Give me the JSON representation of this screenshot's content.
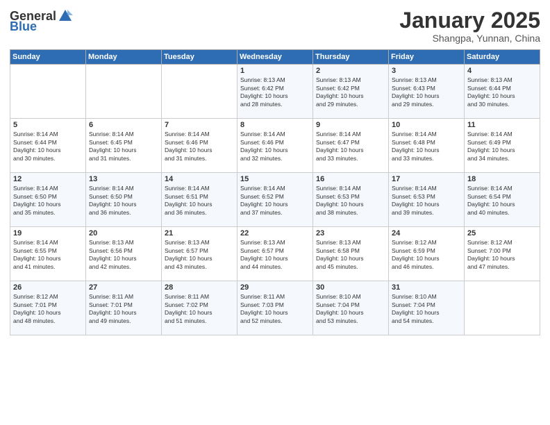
{
  "logo": {
    "text_general": "General",
    "text_blue": "Blue"
  },
  "header": {
    "month_title": "January 2025",
    "location": "Shangpa, Yunnan, China"
  },
  "days_of_week": [
    "Sunday",
    "Monday",
    "Tuesday",
    "Wednesday",
    "Thursday",
    "Friday",
    "Saturday"
  ],
  "weeks": [
    [
      {
        "day": "",
        "info": ""
      },
      {
        "day": "",
        "info": ""
      },
      {
        "day": "",
        "info": ""
      },
      {
        "day": "1",
        "info": "Sunrise: 8:13 AM\nSunset: 6:42 PM\nDaylight: 10 hours\nand 28 minutes."
      },
      {
        "day": "2",
        "info": "Sunrise: 8:13 AM\nSunset: 6:42 PM\nDaylight: 10 hours\nand 29 minutes."
      },
      {
        "day": "3",
        "info": "Sunrise: 8:13 AM\nSunset: 6:43 PM\nDaylight: 10 hours\nand 29 minutes."
      },
      {
        "day": "4",
        "info": "Sunrise: 8:13 AM\nSunset: 6:44 PM\nDaylight: 10 hours\nand 30 minutes."
      }
    ],
    [
      {
        "day": "5",
        "info": "Sunrise: 8:14 AM\nSunset: 6:44 PM\nDaylight: 10 hours\nand 30 minutes."
      },
      {
        "day": "6",
        "info": "Sunrise: 8:14 AM\nSunset: 6:45 PM\nDaylight: 10 hours\nand 31 minutes."
      },
      {
        "day": "7",
        "info": "Sunrise: 8:14 AM\nSunset: 6:46 PM\nDaylight: 10 hours\nand 31 minutes."
      },
      {
        "day": "8",
        "info": "Sunrise: 8:14 AM\nSunset: 6:46 PM\nDaylight: 10 hours\nand 32 minutes."
      },
      {
        "day": "9",
        "info": "Sunrise: 8:14 AM\nSunset: 6:47 PM\nDaylight: 10 hours\nand 33 minutes."
      },
      {
        "day": "10",
        "info": "Sunrise: 8:14 AM\nSunset: 6:48 PM\nDaylight: 10 hours\nand 33 minutes."
      },
      {
        "day": "11",
        "info": "Sunrise: 8:14 AM\nSunset: 6:49 PM\nDaylight: 10 hours\nand 34 minutes."
      }
    ],
    [
      {
        "day": "12",
        "info": "Sunrise: 8:14 AM\nSunset: 6:50 PM\nDaylight: 10 hours\nand 35 minutes."
      },
      {
        "day": "13",
        "info": "Sunrise: 8:14 AM\nSunset: 6:50 PM\nDaylight: 10 hours\nand 36 minutes."
      },
      {
        "day": "14",
        "info": "Sunrise: 8:14 AM\nSunset: 6:51 PM\nDaylight: 10 hours\nand 36 minutes."
      },
      {
        "day": "15",
        "info": "Sunrise: 8:14 AM\nSunset: 6:52 PM\nDaylight: 10 hours\nand 37 minutes."
      },
      {
        "day": "16",
        "info": "Sunrise: 8:14 AM\nSunset: 6:53 PM\nDaylight: 10 hours\nand 38 minutes."
      },
      {
        "day": "17",
        "info": "Sunrise: 8:14 AM\nSunset: 6:53 PM\nDaylight: 10 hours\nand 39 minutes."
      },
      {
        "day": "18",
        "info": "Sunrise: 8:14 AM\nSunset: 6:54 PM\nDaylight: 10 hours\nand 40 minutes."
      }
    ],
    [
      {
        "day": "19",
        "info": "Sunrise: 8:14 AM\nSunset: 6:55 PM\nDaylight: 10 hours\nand 41 minutes."
      },
      {
        "day": "20",
        "info": "Sunrise: 8:13 AM\nSunset: 6:56 PM\nDaylight: 10 hours\nand 42 minutes."
      },
      {
        "day": "21",
        "info": "Sunrise: 8:13 AM\nSunset: 6:57 PM\nDaylight: 10 hours\nand 43 minutes."
      },
      {
        "day": "22",
        "info": "Sunrise: 8:13 AM\nSunset: 6:57 PM\nDaylight: 10 hours\nand 44 minutes."
      },
      {
        "day": "23",
        "info": "Sunrise: 8:13 AM\nSunset: 6:58 PM\nDaylight: 10 hours\nand 45 minutes."
      },
      {
        "day": "24",
        "info": "Sunrise: 8:12 AM\nSunset: 6:59 PM\nDaylight: 10 hours\nand 46 minutes."
      },
      {
        "day": "25",
        "info": "Sunrise: 8:12 AM\nSunset: 7:00 PM\nDaylight: 10 hours\nand 47 minutes."
      }
    ],
    [
      {
        "day": "26",
        "info": "Sunrise: 8:12 AM\nSunset: 7:01 PM\nDaylight: 10 hours\nand 48 minutes."
      },
      {
        "day": "27",
        "info": "Sunrise: 8:11 AM\nSunset: 7:01 PM\nDaylight: 10 hours\nand 49 minutes."
      },
      {
        "day": "28",
        "info": "Sunrise: 8:11 AM\nSunset: 7:02 PM\nDaylight: 10 hours\nand 51 minutes."
      },
      {
        "day": "29",
        "info": "Sunrise: 8:11 AM\nSunset: 7:03 PM\nDaylight: 10 hours\nand 52 minutes."
      },
      {
        "day": "30",
        "info": "Sunrise: 8:10 AM\nSunset: 7:04 PM\nDaylight: 10 hours\nand 53 minutes."
      },
      {
        "day": "31",
        "info": "Sunrise: 8:10 AM\nSunset: 7:04 PM\nDaylight: 10 hours\nand 54 minutes."
      },
      {
        "day": "",
        "info": ""
      }
    ]
  ]
}
